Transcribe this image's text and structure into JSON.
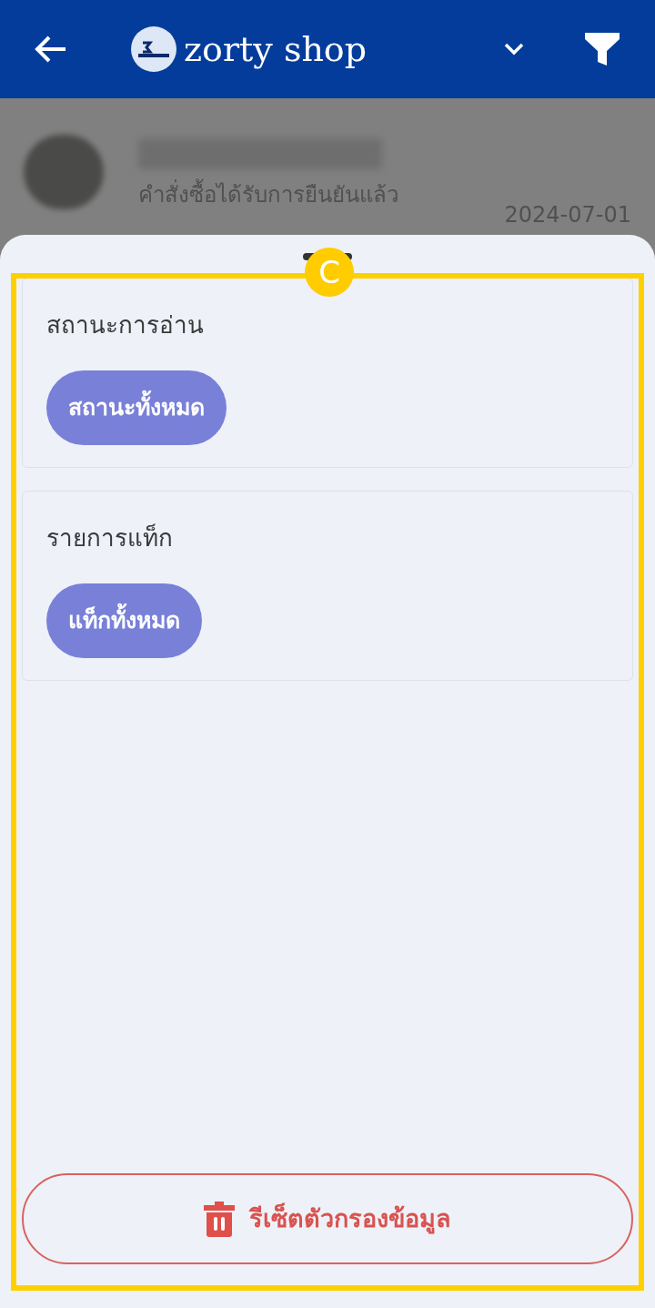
{
  "app_bar": {
    "title": "zorty shop"
  },
  "background_list": [
    {
      "status": "คำสั่งซื้อได้รับการยืนยันแล้ว",
      "date": "2024-07-01"
    }
  ],
  "annotation": {
    "label": "C"
  },
  "filter_sections": [
    {
      "title": "สถานะการอ่าน",
      "chips": [
        {
          "label": "สถานะทั้งหมด",
          "selected": true
        }
      ]
    },
    {
      "title": "รายการแท็ก",
      "chips": [
        {
          "label": "แท็กทั้งหมด",
          "selected": true
        }
      ]
    }
  ],
  "reset_button": {
    "label": "รีเซ็ตตัวกรองข้อมูล"
  }
}
